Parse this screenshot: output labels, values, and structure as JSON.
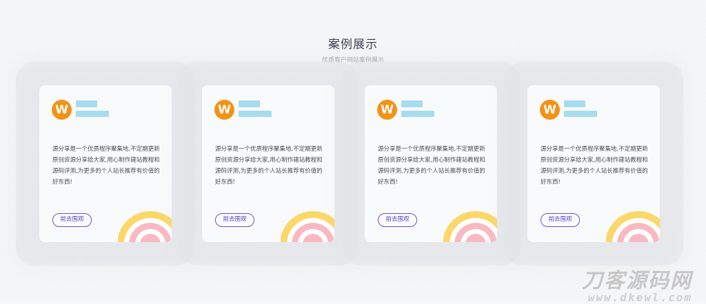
{
  "section": {
    "title": "案例展示",
    "subtitle": "优质客户网站案例展示"
  },
  "cards": [
    {
      "avatar_letter": "W",
      "description": "源分享是一个优质程序聚集地,不定期更新原创资源分享给大家,用心制作建站教程和源码评测,为更多的个人站长推荐有价值的好东西!",
      "button_label": "前去围观"
    },
    {
      "avatar_letter": "W",
      "description": "源分享是一个优质程序聚集地,不定期更新原创资源分享给大家,用心制作建站教程和源码评测,为更多的个人站长推荐有价值的好东西!",
      "button_label": "前去围观"
    },
    {
      "avatar_letter": "W",
      "description": "源分享是一个优质程序聚集地,不定期更新原创资源分享给大家,用心制作建站教程和源码评测,为更多的个人站长推荐有价值的好东西!",
      "button_label": "前去围观"
    },
    {
      "avatar_letter": "W",
      "description": "源分享是一个优质程序聚集地,不定期更新原创资源分享给大家,用心制作建站教程和源码评测,为更多的个人站长推荐有价值的好东西!",
      "button_label": "前去围观"
    }
  ],
  "colors": {
    "avatar_bg": "#f39314",
    "button_border": "#6f4dd8",
    "rainbow_outer": "#fcd769",
    "rainbow_middle": "#f9b9c2",
    "rainbow_inner": "#ffffff"
  },
  "watermark": {
    "brand": "刀客源码网",
    "url": "www.dkewl.com"
  }
}
